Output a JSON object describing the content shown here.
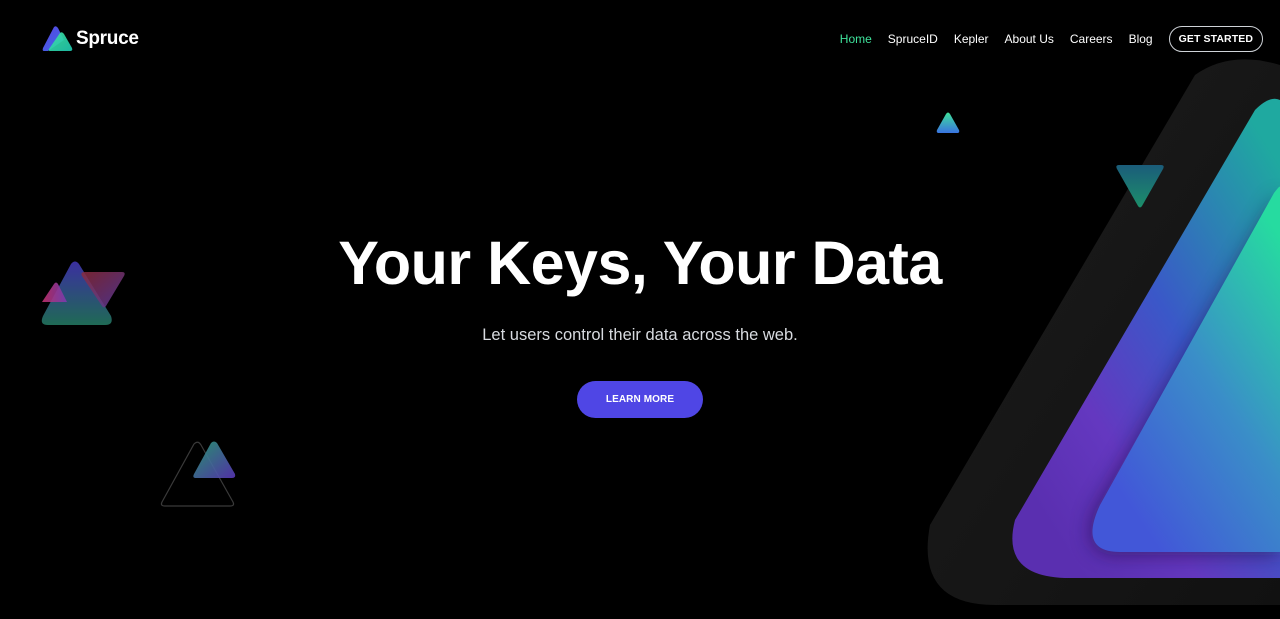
{
  "brand": {
    "name": "Spruce",
    "logo_icon": "spruce-triangle-logo-icon"
  },
  "nav": {
    "items": [
      {
        "label": "Home",
        "active": true
      },
      {
        "label": "SpruceID",
        "active": false
      },
      {
        "label": "Kepler",
        "active": false
      },
      {
        "label": "About Us",
        "active": false
      },
      {
        "label": "Careers",
        "active": false
      },
      {
        "label": "Blog",
        "active": false
      }
    ],
    "cta_label": "GET STARTED"
  },
  "hero": {
    "title": "Your Keys, Your Data",
    "subtitle": "Let users control their data across the web.",
    "button_label": "LEARN MORE"
  },
  "colors": {
    "background": "#000000",
    "nav_active": "#3ee29b",
    "primary_button": "#4f46e5",
    "gradient_green": "#2ee6a0",
    "gradient_blue": "#3d5be0",
    "gradient_purple": "#6a3dc4"
  }
}
